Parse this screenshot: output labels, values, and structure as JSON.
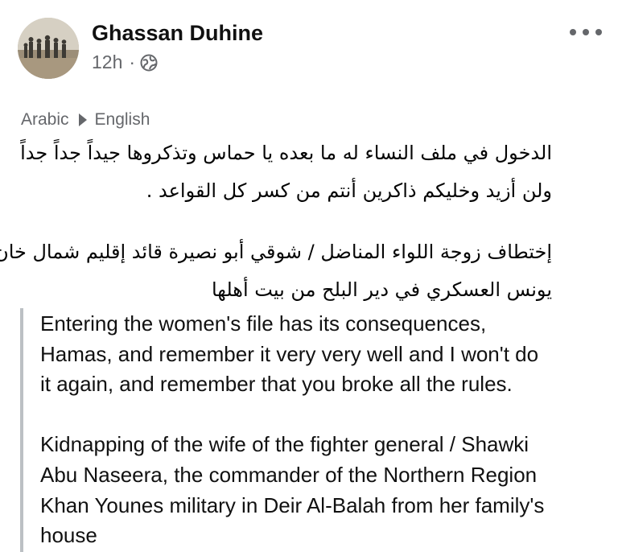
{
  "post": {
    "author": "Ghassan Duhine",
    "time": "12h",
    "separator": "·",
    "visibility_icon": "globe-icon",
    "more_icon": "more-horizontal-icon"
  },
  "translation": {
    "source_language": "Arabic",
    "target_language": "English",
    "arrow_icon": "play-triangle-icon"
  },
  "arabic_text": {
    "line1": "الدخول في ملف النساء له ما بعده يا حماس وتذكروها جيداً جداً جداً",
    "line2": "ولن أزيد وخليكم ذاكرين أنتم من كسر كل القواعد .",
    "line3": "إختطاف زوجة اللواء المناضل / شوقي أبو نصيرة قائد إقليم شمال خان",
    "line4": "يونس العسكري في دير البلح من بيت أهلها"
  },
  "english_text": {
    "line1": "Entering the women's file has its consequences,",
    "line2": "Hamas, and remember it very very well and I won't do",
    "line3": "it again, and remember that you broke all the rules.",
    "line4": "Kidnapping of the wife of the fighter general / Shawki",
    "line5": "Abu Naseera, the commander of the Northern Region",
    "line6": "Khan Younes military in Deir Al-Balah from her family's",
    "line7": "house"
  }
}
